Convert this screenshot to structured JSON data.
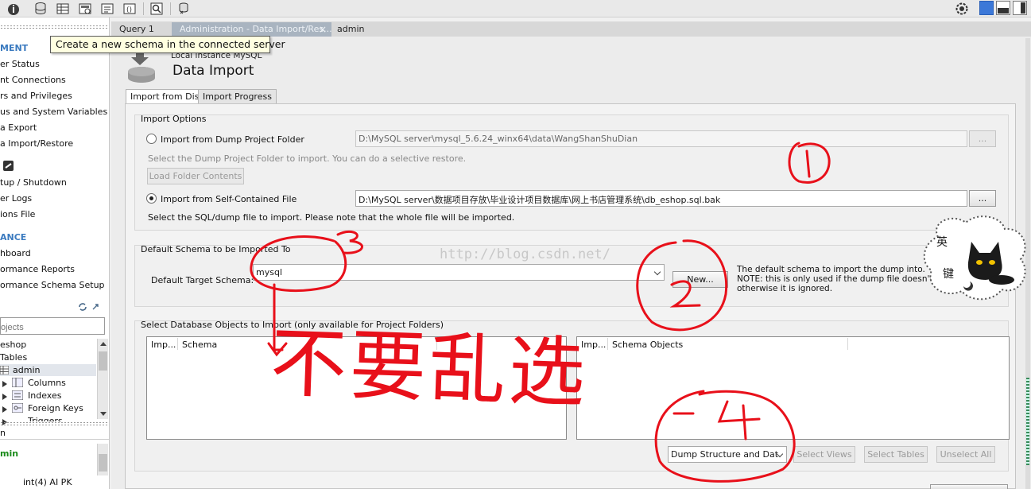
{
  "toolbar": {
    "icons": [
      "info-icon",
      "new-schema-icon",
      "new-table-icon",
      "new-view-icon",
      "new-routine-icon",
      "new-function-icon",
      "search-table-icon",
      "reconnect-icon",
      "settings-icon"
    ]
  },
  "tooltip": "Create a new schema in the connected server",
  "tabs": {
    "query": "Query 1",
    "admin_tab": "Administration - Data Import/Res...",
    "admin_tab_close": "×",
    "admin_label": "admin"
  },
  "sidebar": {
    "management_header": "MENT",
    "management": [
      "er Status",
      "nt Connections",
      "rs and Privileges",
      "us and System Variables",
      "a Export",
      "a Import/Restore"
    ],
    "instance": [
      "tup / Shutdown",
      "er Logs",
      "ions File"
    ],
    "performance_header": "ANCE",
    "performance": [
      "hboard",
      "ormance Reports",
      "ormance Schema Setup"
    ],
    "search_placeholder": "ojects",
    "tree": {
      "schema": "eshop",
      "tables": "Tables",
      "table": "admin",
      "columns": "Columns",
      "indexes": "Indexes",
      "foreign_keys": "Foreign Keys",
      "triggers": "Triggers"
    },
    "info_header": "n",
    "info_name": "min",
    "info_detail": "int(4) AI PK"
  },
  "main": {
    "subtitle": "Local instance MySQL",
    "title": "Data Import",
    "subtab_disk": "Import from Disk",
    "subtab_progress": "Import Progress",
    "import_options_title": "Import Options",
    "folder_radio_label": "Import from Dump Project Folder",
    "folder_path": "D:\\MySQL server\\mysql_5.6.24_winx64\\data\\WangShanShuDian",
    "folder_hint": "Select the Dump Project Folder to import. You can do a selective restore.",
    "load_folder_button": "Load Folder Contents",
    "browse_label": "...",
    "file_radio_label": "Import from Self-Contained File",
    "file_path": "D:\\MySQL server\\数据项目存放\\毕业设计项目数据库\\网上书店管理系统\\db_eshop.sql.bak",
    "file_hint": "Select the SQL/dump file to import. Please note that the whole file will be imported.",
    "schema_group_title": "Default Schema to be Imported To",
    "target_schema_label": "Default Target Schema:",
    "target_schema_value": "mysql",
    "new_button": "New...",
    "note_line1": "The default schema to import the dump into.",
    "note_line2": "NOTE: this is only used if the dump file doesn't contain",
    "note_line3": "otherwise it is ignored.",
    "objects_group_title": "Select Database Objects to Import (only available for Project Folders)",
    "left_table_headers": [
      "Imp...",
      "Schema"
    ],
    "right_table_headers": [
      "Imp...",
      "Schema Objects"
    ],
    "dump_select_value": "Dump Structure and Dat",
    "select_views_button": "Select Views",
    "select_tables_button": "Select Tables",
    "unselect_all_button": "Unselect All"
  },
  "watermark": "http://blog.csdn.net/",
  "ime": {
    "char1": "英",
    "char2": "键"
  },
  "annotations": {
    "marks": [
      "1",
      "2",
      "3",
      "4"
    ],
    "text": "不要乱选",
    "color": "#e8101a"
  }
}
